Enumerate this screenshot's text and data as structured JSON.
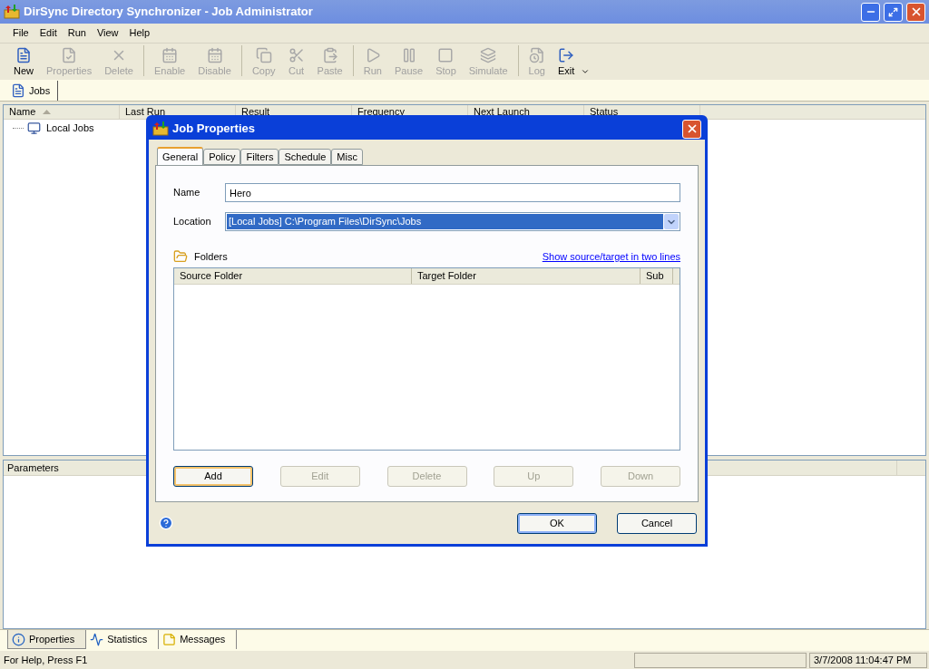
{
  "window": {
    "title": "DirSync Directory Synchronizer - Job Administrator"
  },
  "menu": [
    "File",
    "Edit",
    "Run",
    "View",
    "Help"
  ],
  "toolbar": [
    [
      {
        "label": "New",
        "disabled": false
      },
      {
        "label": "Properties",
        "disabled": true
      },
      {
        "label": "Delete",
        "disabled": true
      }
    ],
    [
      {
        "label": "Enable",
        "disabled": true
      },
      {
        "label": "Disable",
        "disabled": true
      }
    ],
    [
      {
        "label": "Copy",
        "disabled": true
      },
      {
        "label": "Cut",
        "disabled": true
      },
      {
        "label": "Paste",
        "disabled": true
      }
    ],
    [
      {
        "label": "Run",
        "disabled": true
      },
      {
        "label": "Pause",
        "disabled": true
      },
      {
        "label": "Stop",
        "disabled": true
      },
      {
        "label": "Simulate",
        "disabled": true
      }
    ],
    [
      {
        "label": "Log",
        "disabled": true
      },
      {
        "label": "Exit",
        "disabled": false
      }
    ]
  ],
  "doc_tabs": [
    {
      "label": "Jobs",
      "selected": true
    }
  ],
  "jobs_table": {
    "columns": [
      "Name",
      "Last Run",
      "Result",
      "Frequency",
      "Next Launch",
      "Status"
    ],
    "tree": [
      {
        "label": "Local Jobs"
      }
    ]
  },
  "parameters": {
    "title": "Parameters"
  },
  "bottom_tabs": [
    {
      "label": "Properties",
      "selected": true
    },
    {
      "label": "Statistics",
      "selected": false
    },
    {
      "label": "Messages",
      "selected": false
    }
  ],
  "status_bar": {
    "help": "For Help, Press F1",
    "datetime": "3/7/2008 11:04:47 PM"
  },
  "dialog": {
    "title": "Job Properties",
    "tabs": [
      {
        "label": "General",
        "selected": true
      },
      {
        "label": "Policy",
        "selected": false
      },
      {
        "label": "Filters",
        "selected": false
      },
      {
        "label": "Schedule",
        "selected": false
      },
      {
        "label": "Misc",
        "selected": false
      }
    ],
    "name_label": "Name",
    "name_value": "Hero",
    "location_label": "Location",
    "location_value": "[Local Jobs] C:\\Program Files\\DirSync\\Jobs",
    "folders_label": "Folders",
    "link": "Show source/target in two lines",
    "folder_columns": [
      "Source Folder",
      "Target Folder",
      "Sub"
    ],
    "folder_buttons": [
      {
        "label": "Add",
        "disabled": false
      },
      {
        "label": "Edit",
        "disabled": true
      },
      {
        "label": "Delete",
        "disabled": true
      },
      {
        "label": "Up",
        "disabled": true
      },
      {
        "label": "Down",
        "disabled": true
      }
    ],
    "buttons": [
      {
        "label": "OK",
        "focused": true
      },
      {
        "label": "Cancel",
        "focused": false
      }
    ]
  }
}
